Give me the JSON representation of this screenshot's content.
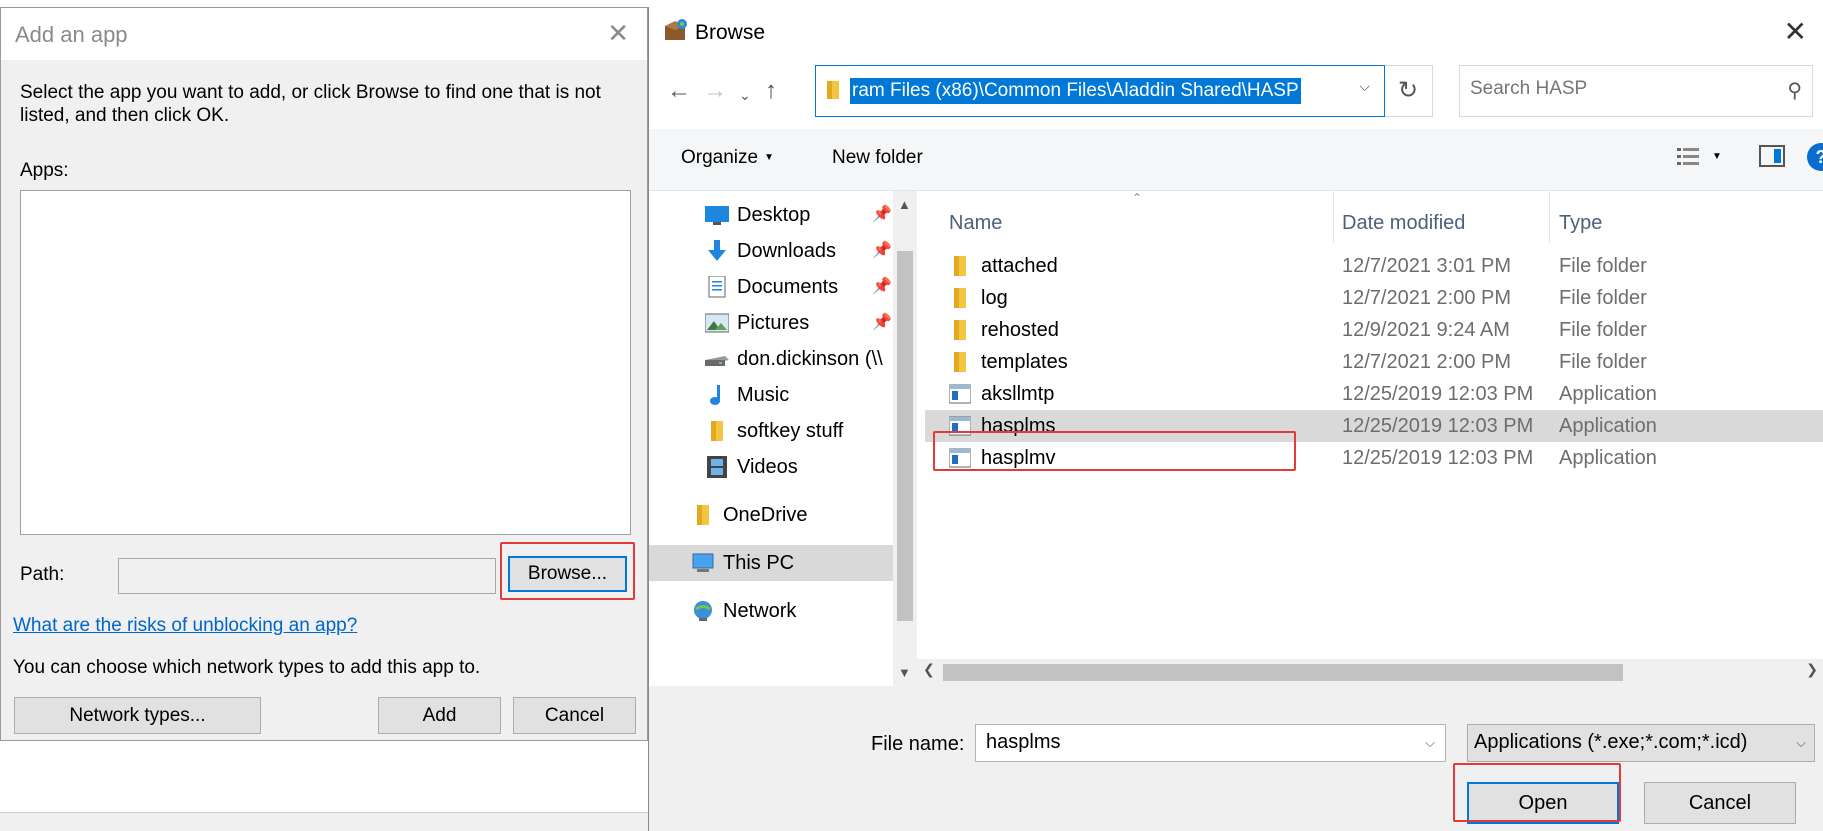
{
  "add_app": {
    "title": "Add an app",
    "close_glyph": "✕",
    "instructions": "Select the app you want to add, or click Browse to find one that is not listed, and then click OK.",
    "apps_label": "Apps:",
    "path_label": "Path:",
    "path_value": "",
    "browse_label": "Browse...",
    "risks_link": "What are the risks of unblocking an app?",
    "network_text": "You can choose which network types to add this app to.",
    "network_types_label": "Network types...",
    "add_label": "Add",
    "cancel_label": "Cancel"
  },
  "browse": {
    "title": "Browse",
    "close_glyph": "✕",
    "address_path": "ram Files (x86)\\Common Files\\Aladdin Shared\\HASP",
    "search_placeholder": "Search HASP",
    "toolbar": {
      "organize_label": "Organize",
      "new_folder_label": "New folder",
      "help_label": "?"
    },
    "nav_items": [
      {
        "label": "Desktop",
        "icon": "desktop-icon",
        "pinned": true
      },
      {
        "label": "Downloads",
        "icon": "downloads-icon",
        "pinned": true
      },
      {
        "label": "Documents",
        "icon": "documents-icon",
        "pinned": true
      },
      {
        "label": "Pictures",
        "icon": "pictures-icon",
        "pinned": true
      },
      {
        "label": "don.dickinson (\\\\",
        "icon": "network-drive-icon",
        "pinned": false
      },
      {
        "label": "Music",
        "icon": "music-icon",
        "pinned": false
      },
      {
        "label": "softkey stuff",
        "icon": "folder-icon",
        "pinned": false
      },
      {
        "label": "Videos",
        "icon": "videos-icon",
        "pinned": false
      },
      {
        "label": "OneDrive",
        "icon": "folder-icon",
        "pinned": false
      },
      {
        "label": "This PC",
        "icon": "computer-icon",
        "pinned": false
      },
      {
        "label": "Network",
        "icon": "network-icon",
        "pinned": false
      }
    ],
    "columns": {
      "name": "Name",
      "date": "Date modified",
      "type": "Type"
    },
    "files": [
      {
        "name": "attached",
        "date": "12/7/2021 3:01 PM",
        "type": "File folder",
        "icon": "folder-icon"
      },
      {
        "name": "log",
        "date": "12/7/2021 2:00 PM",
        "type": "File folder",
        "icon": "folder-icon"
      },
      {
        "name": "rehosted",
        "date": "12/9/2021 9:24 AM",
        "type": "File folder",
        "icon": "folder-icon"
      },
      {
        "name": "templates",
        "date": "12/7/2021 2:00 PM",
        "type": "File folder",
        "icon": "folder-icon"
      },
      {
        "name": "aksllmtp",
        "date": "12/25/2019 12:03 PM",
        "type": "Application",
        "icon": "application-icon"
      },
      {
        "name": "hasplms",
        "date": "12/25/2019 12:03 PM",
        "type": "Application",
        "icon": "application-icon",
        "selected": true
      },
      {
        "name": "hasplmv",
        "date": "12/25/2019 12:03 PM",
        "type": "Application",
        "icon": "application-icon"
      }
    ],
    "file_name_label": "File name:",
    "file_name_value": "hasplms",
    "file_type_value": "Applications (*.exe;*.com;*.icd)",
    "open_label": "Open",
    "cancel_label": "Cancel"
  },
  "colors": {
    "accent": "#0078d7",
    "highlight": "#e23b3b",
    "folder": "#f4c542",
    "link": "#0066cc"
  }
}
